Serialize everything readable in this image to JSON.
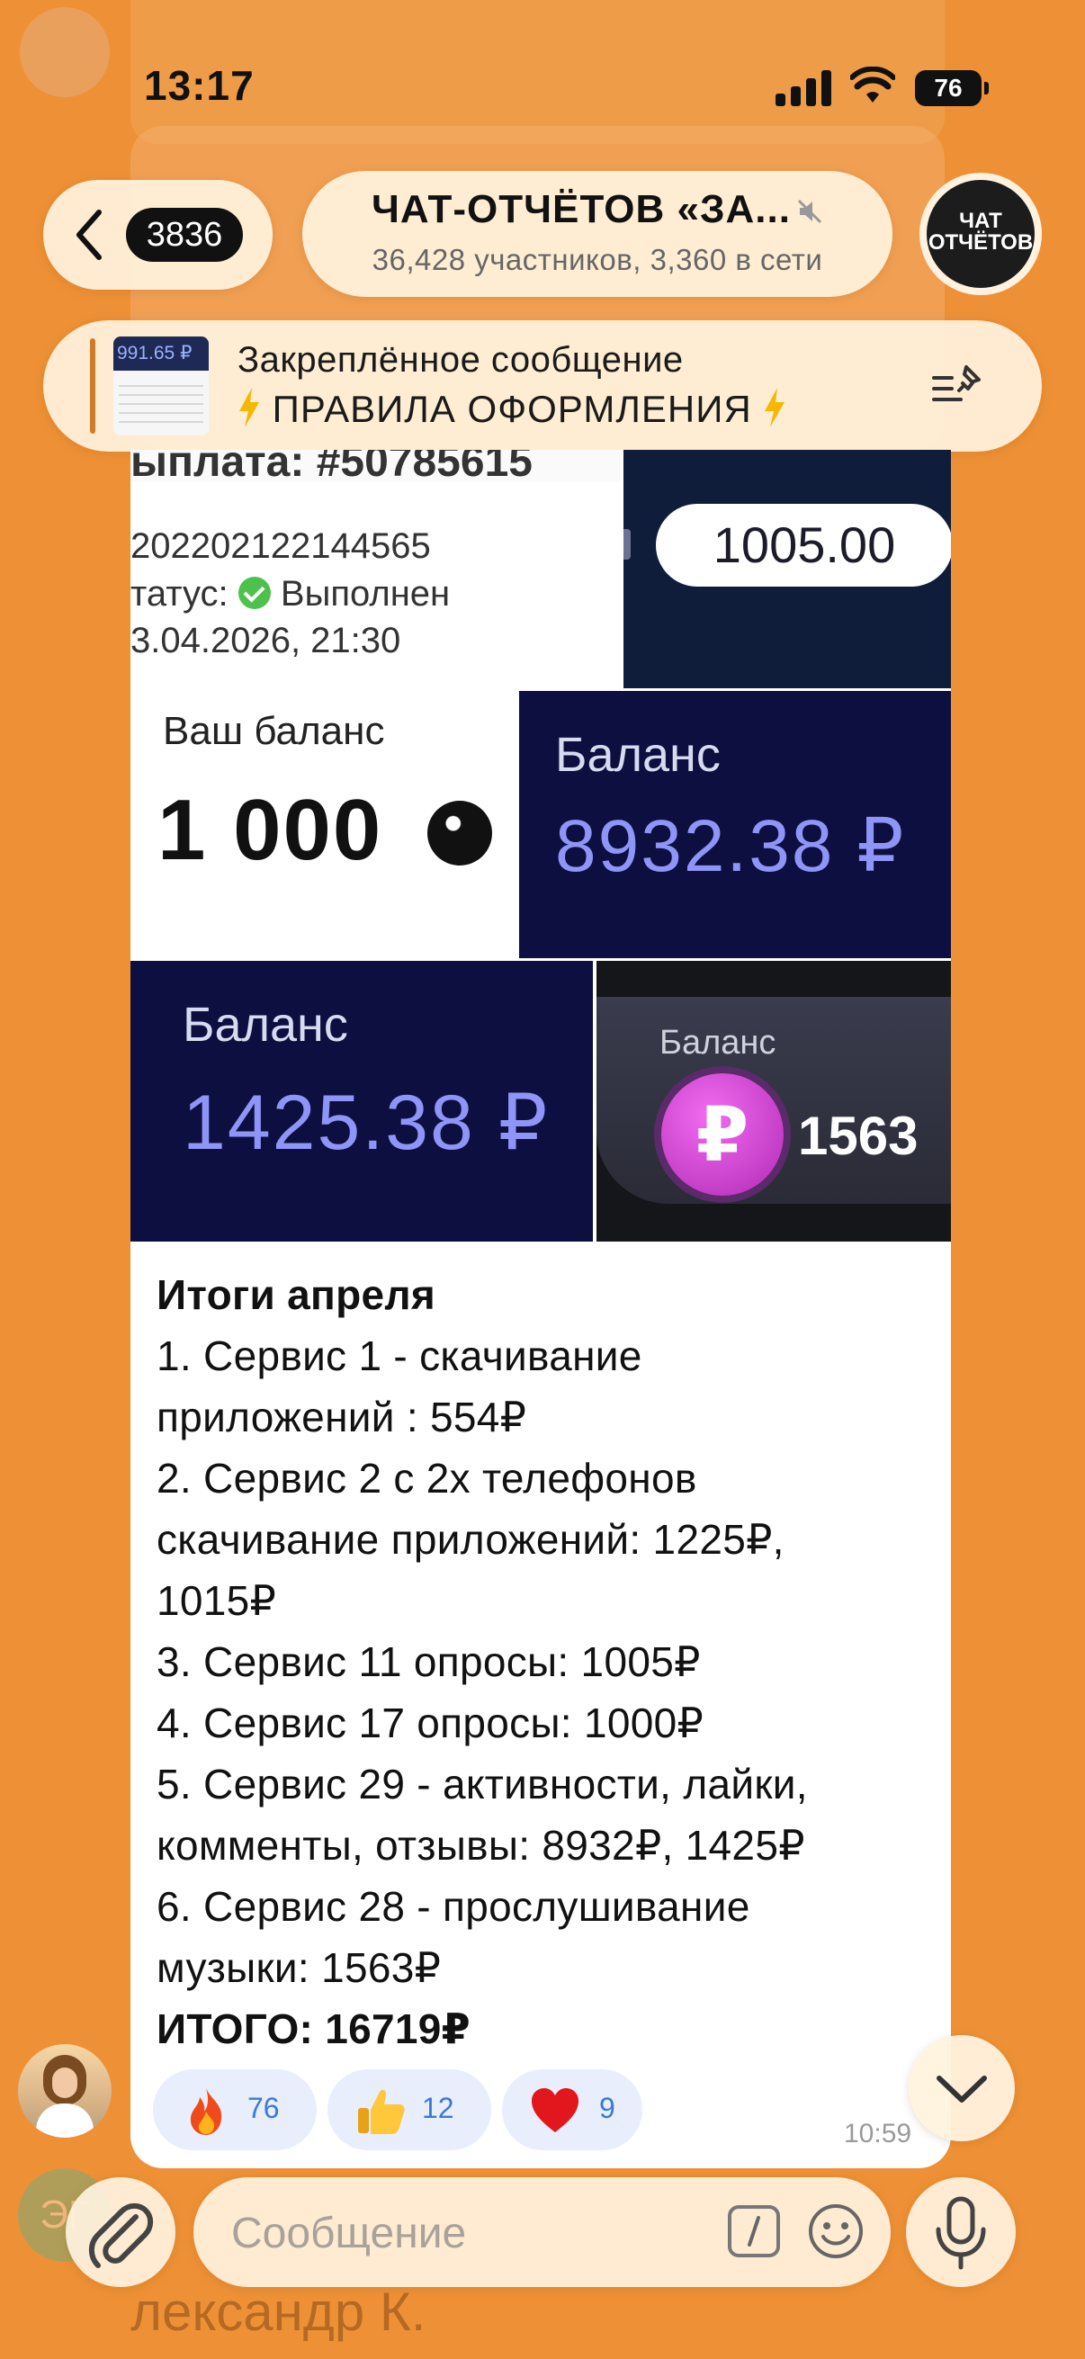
{
  "status_bar": {
    "time": "13:17",
    "battery": "76"
  },
  "header": {
    "back_count": "3836",
    "title": "ЧАТ-ОТЧЁТОВ «ЗА...",
    "subtitle": "36,428 участников, 3,360 в сети",
    "avatar_text_line1": "ЧАТ",
    "avatar_text_line2": "ОТЧЁТОВ"
  },
  "pinned": {
    "title": "Закреплённое сообщение",
    "text": "ПРАВИЛА ОФОРМЛЕНИЯ",
    "thumb_value": "991.65 ₽"
  },
  "background": {
    "bottom_text": "лександр К.",
    "avatar_initials": "ЭГ"
  },
  "message": {
    "images": {
      "payout_header": "ыплата: #50785615",
      "payout_id": "202202122144565",
      "payout_status_label": "татус:",
      "payout_status_value": "Выполнен",
      "payout_datetime": "3.04.2026, 21:30",
      "payout_amount": "1005.00",
      "balance1_label": "Ваш баланс",
      "balance1_value": "1 000",
      "balance2_label": "Баланс",
      "balance2_value": "8932.38 ₽",
      "balance3_label": "Баланс",
      "balance3_value": "1425.38 ₽",
      "balance4_label": "Баланс",
      "balance4_coin": "₽",
      "balance4_value": "1563"
    },
    "lines": [
      "Итоги апреля",
      "1. Сервис 1 - скачивание",
      "приложений : 554₽",
      "2. Сервис 2 с 2х телефонов",
      "скачивание приложений: 1225₽,",
      "1015₽",
      "3. Сервис 11 опросы: 1005₽",
      "4. Сервис 17 опросы: 1000₽",
      "5. Сервис 29 - активности, лайки,",
      "комменты, отзывы: 8932₽, 1425₽",
      "6. Сервис 28 - прослушивание",
      "музыки: 1563₽",
      "ИТОГО: 16719₽"
    ],
    "reactions": [
      {
        "emoji": "fire-icon",
        "count": "76"
      },
      {
        "emoji": "thumbs-up-icon",
        "count": "12"
      },
      {
        "emoji": "heart-icon",
        "count": "9"
      }
    ],
    "time": "10:59"
  },
  "composer": {
    "placeholder": "Сообщение"
  },
  "colors": {
    "background": "#ee9136",
    "accent": "#3b79d8",
    "reaction_bg": "#e8eefc",
    "balance_tile": "#0c0f40",
    "balance_value": "#8f95f7"
  }
}
